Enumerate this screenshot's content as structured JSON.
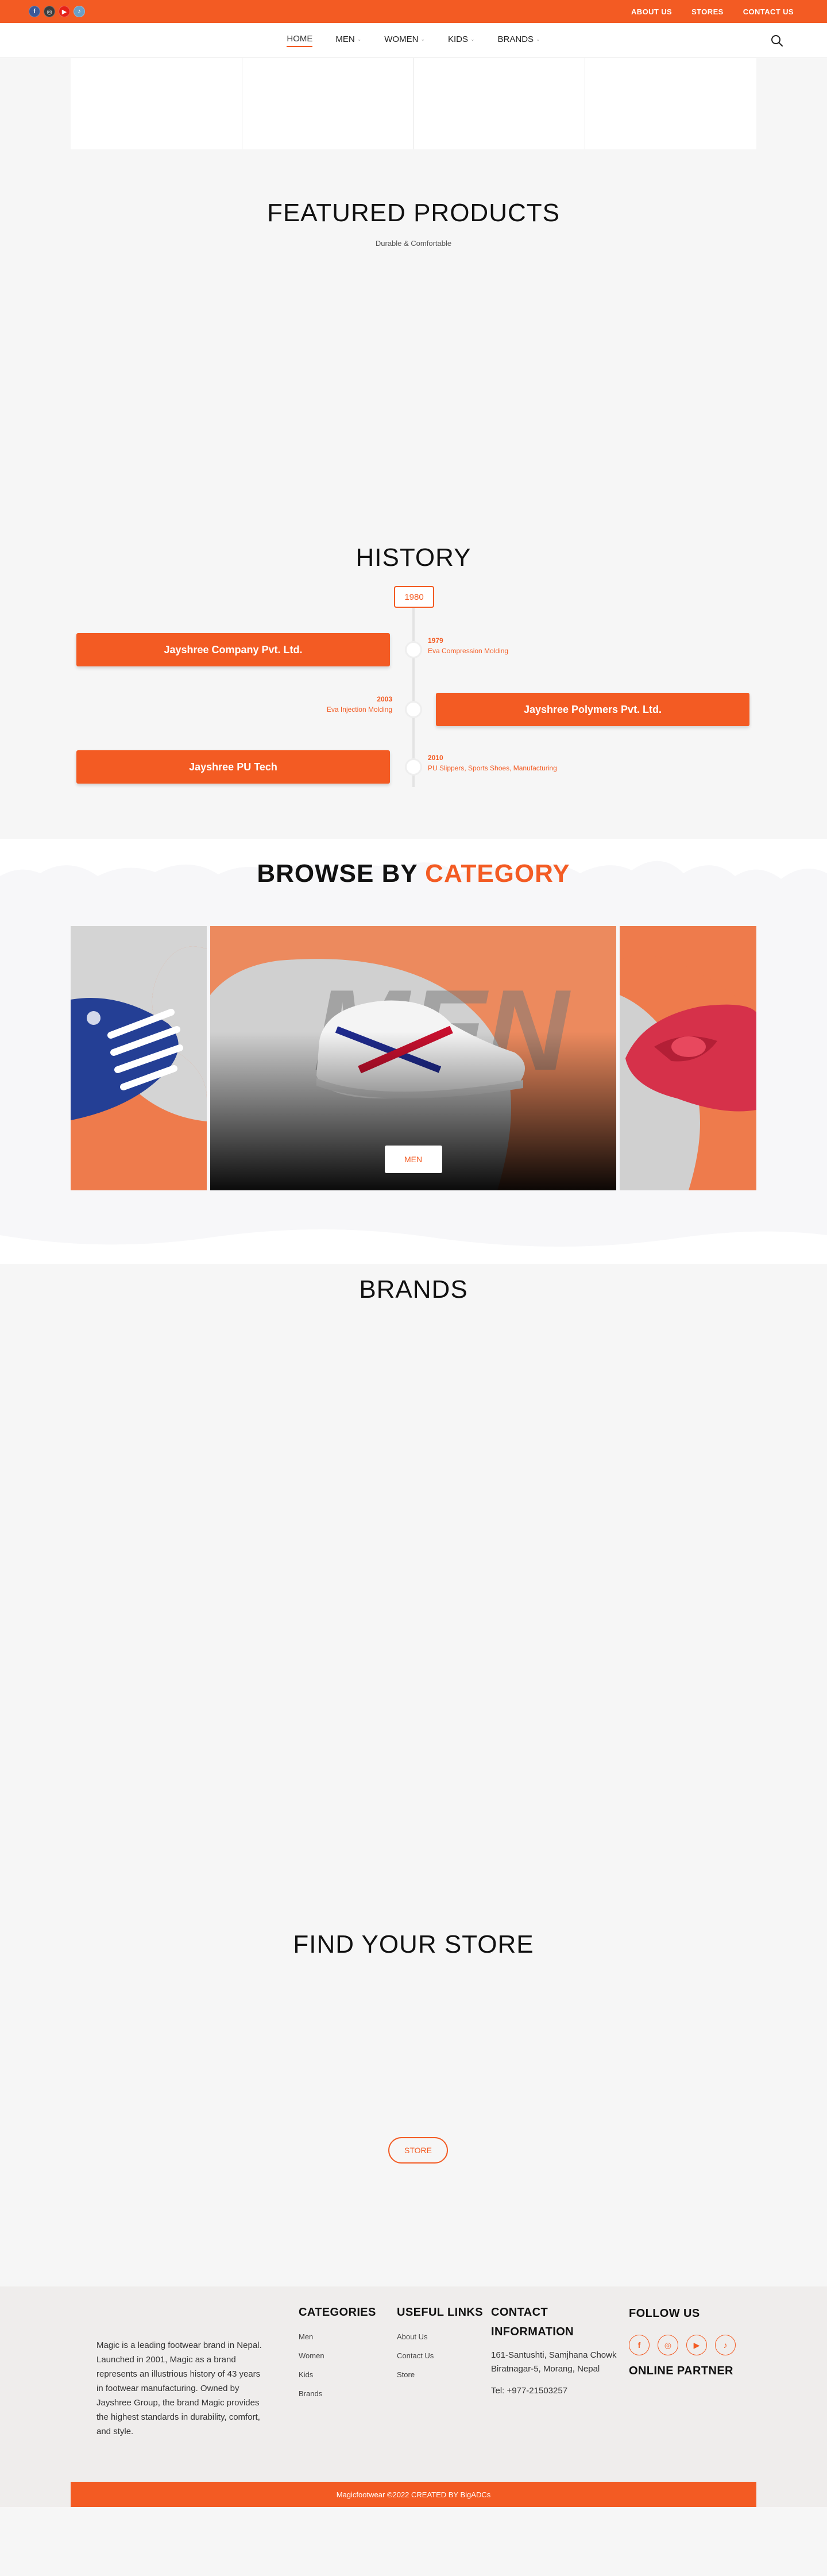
{
  "topbar": {
    "social": [
      {
        "name": "facebook-icon",
        "glyph": "f"
      },
      {
        "name": "instagram-icon",
        "glyph": "◎"
      },
      {
        "name": "youtube-icon",
        "glyph": "▶"
      },
      {
        "name": "tiktok-icon",
        "glyph": "♪"
      }
    ],
    "links": [
      "ABOUT US",
      "STORES",
      "CONTACT US"
    ]
  },
  "nav": {
    "items": [
      "HOME",
      "MEN",
      "WOMEN",
      "KIDS",
      "BRANDS"
    ],
    "active": "HOME"
  },
  "featured": {
    "title": "FEATURED PRODUCTS",
    "subtitle": "Durable & Comfortable"
  },
  "history": {
    "title": "HISTORY",
    "start_year": "1980",
    "cards": [
      "Jayshree Company Pvt. Ltd.",
      "Jayshree Polymers Pvt. Ltd.",
      "Jayshree PU Tech"
    ],
    "notes": [
      {
        "year": "1979",
        "text": "Eva Compression Molding"
      },
      {
        "year": "2003",
        "text": "Eva Injection Molding"
      },
      {
        "year": "2010",
        "text": "PU Slippers, Sports Shoes, Manufacturing"
      }
    ]
  },
  "browse": {
    "title_main": "BROWSE BY",
    "title_accent": "CATEGORY",
    "active_button": "MEN"
  },
  "brands": {
    "title": "BRANDS"
  },
  "store": {
    "title": "FIND YOUR STORE",
    "button": "STORE"
  },
  "footer": {
    "about": "Magic is a leading footwear brand in Nepal. Launched in 2001, Magic as a brand represents an illustrious history of 43 years in footwear manufacturing. Owned by Jayshree Group, the brand Magic provides the highest standards in durability, comfort, and style.",
    "categories": {
      "title": "CATEGORIES",
      "links": [
        "Men",
        "Women",
        "Kids",
        "Brands"
      ]
    },
    "useful": {
      "title": "USEFUL LINKS",
      "links": [
        "About Us",
        "Contact Us",
        "Store"
      ]
    },
    "contact": {
      "title_line1": "CONTACT",
      "title_line2": "INFORMATION",
      "address": "161-Santushti, Samjhana Chowk",
      "city": "Biratnagar-5, Morang, Nepal",
      "tel": "Tel: +977-21503257"
    },
    "follow": {
      "title": "FOLLOW US",
      "online": "ONLINE PARTNER"
    },
    "copyright": "Magicfootwear ©2022 CREATED BY BigADCs"
  },
  "colors": {
    "accent": "#f35b23",
    "dark": "#111111",
    "background": "#f6f6f6"
  }
}
